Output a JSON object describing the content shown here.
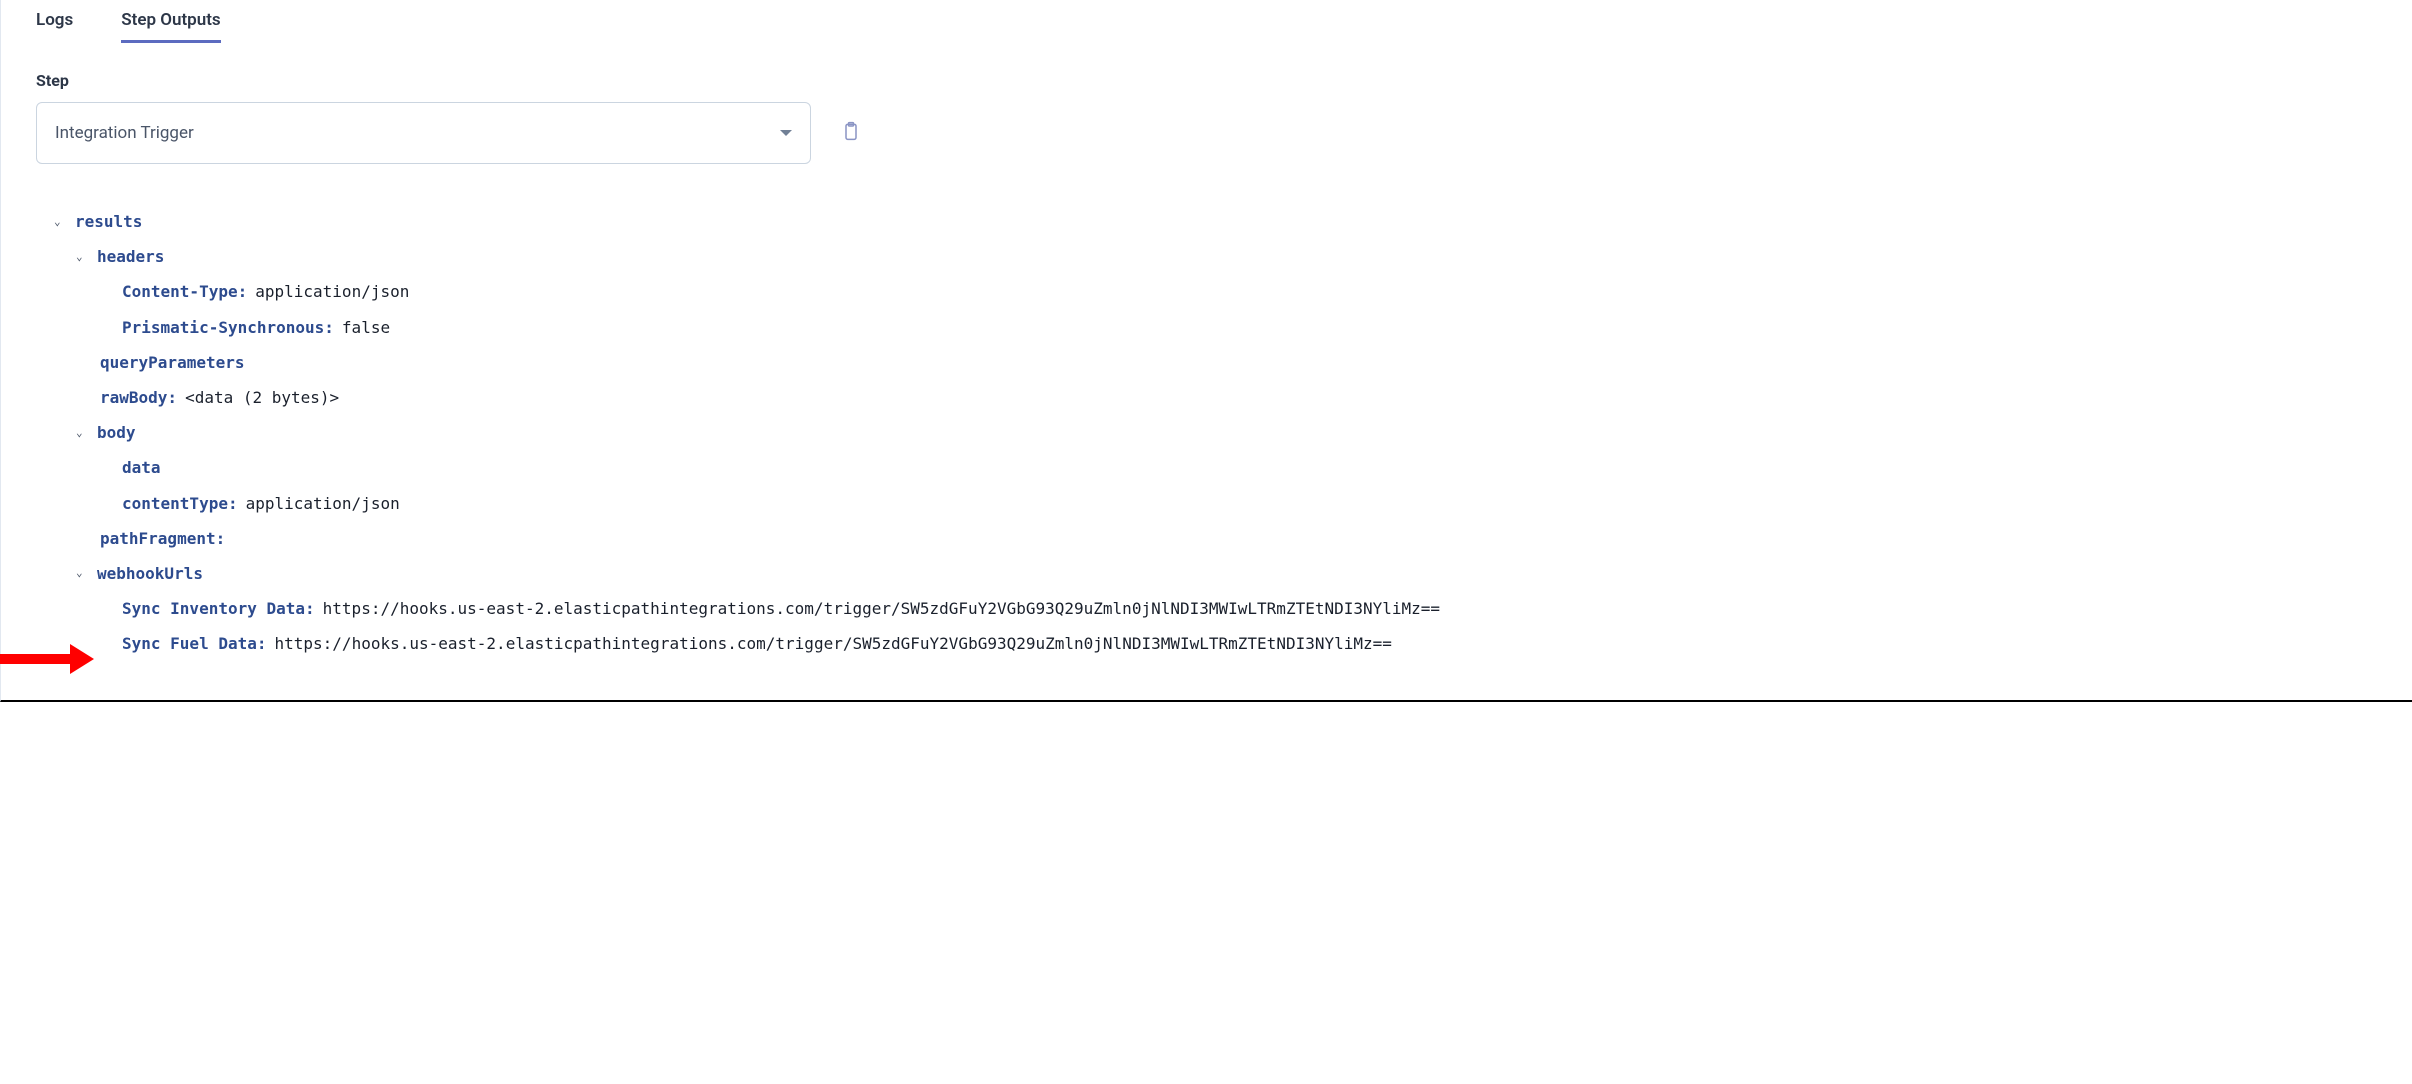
{
  "tabs": {
    "logs": "Logs",
    "outputs": "Step Outputs"
  },
  "step": {
    "label": "Step",
    "selected": "Integration Trigger"
  },
  "tree": {
    "results": "results",
    "headers": "headers",
    "contentTypeKey": "Content-Type:",
    "contentTypeVal": "application/json",
    "prismaticSyncKey": "Prismatic-Synchronous:",
    "prismaticSyncVal": "false",
    "queryParameters": "queryParameters",
    "rawBodyKey": "rawBody:",
    "rawBodyVal": "<data (2 bytes)>",
    "body": "body",
    "data": "data",
    "bodyContentTypeKey": "contentType:",
    "bodyContentTypeVal": "application/json",
    "pathFragment": "pathFragment:",
    "webhookUrls": "webhookUrls",
    "syncInventoryKey": "Sync Inventory Data:",
    "syncInventoryVal": "https://hooks.us-east-2.elasticpathintegrations.com/trigger/SW5zdGFuY2VGbG93Q29uZmln0jNlNDI3MWIwLTRmZTEtNDI3NYliMz==",
    "syncFuelKey": "Sync Fuel Data:",
    "syncFuelVal": "https://hooks.us-east-2.elasticpathintegrations.com/trigger/SW5zdGFuY2VGbG93Q29uZmln0jNlNDI3MWIwLTRmZTEtNDI3NYliMz=="
  }
}
